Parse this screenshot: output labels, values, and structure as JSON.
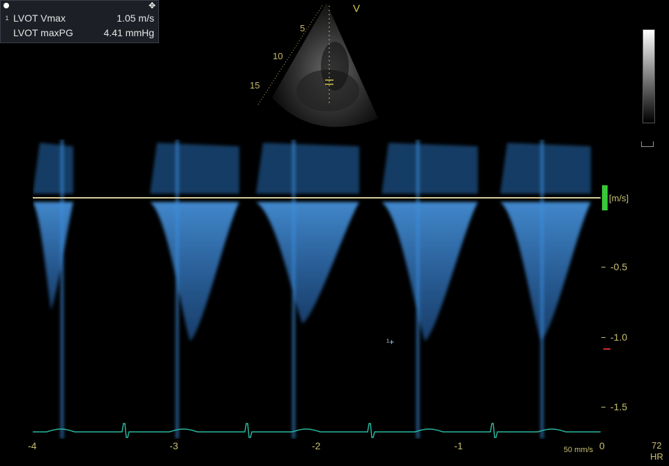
{
  "measurements": {
    "items": [
      {
        "index": "1",
        "name": "LVOT Vmax",
        "value": "1.05 m/s"
      },
      {
        "index": "",
        "name": "LVOT maxPG",
        "value": "4.41 mmHg"
      }
    ]
  },
  "sector": {
    "depth_labels": [
      "5",
      "10",
      "15"
    ],
    "marker": "V"
  },
  "doppler": {
    "unit": "[m/s]",
    "velocity_ticks": [
      "-0.5",
      "-1.0",
      "-1.5"
    ],
    "time_ticks": [
      "-4",
      "-3",
      "-2",
      "-1",
      "0"
    ],
    "sweep_speed": "50 mm/s",
    "colors": {
      "spectrum": "#3a8ee0",
      "ecg": "#2ab7a0",
      "baseline": "#d8cf9a"
    }
  },
  "hr": {
    "value": "72",
    "label": "HR"
  },
  "icons": [
    "circle-dot-icon",
    "move-icon",
    "cursor-icon"
  ]
}
